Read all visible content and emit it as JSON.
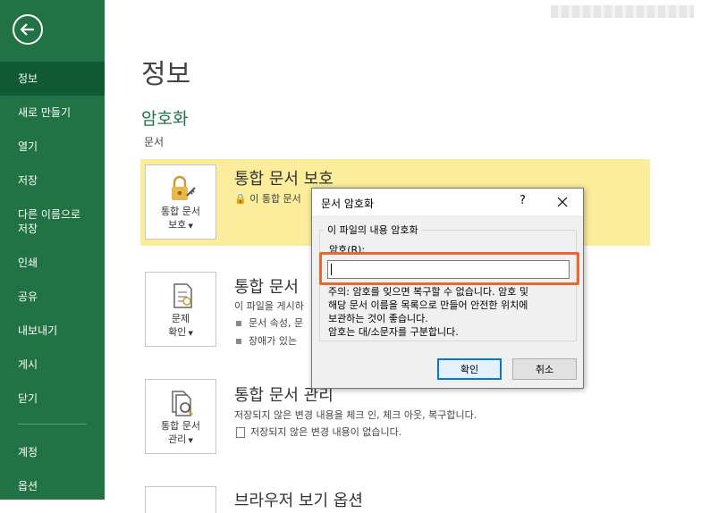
{
  "sidebar": {
    "items": [
      {
        "label": "정보"
      },
      {
        "label": "새로 만들기"
      },
      {
        "label": "열기"
      },
      {
        "label": "저장"
      },
      {
        "label": "다른 이름으로\n저장"
      },
      {
        "label": "인쇄"
      },
      {
        "label": "공유"
      },
      {
        "label": "내보내기"
      },
      {
        "label": "게시"
      },
      {
        "label": "닫기"
      },
      {
        "label": "계정"
      },
      {
        "label": "옵션"
      }
    ]
  },
  "page": {
    "title": "정보",
    "section_title": "암호화",
    "section_sub": "문서"
  },
  "cards": {
    "protect": {
      "tile_label_1": "통합 문서",
      "tile_label_2": "보호",
      "title": "통합 문서 보호",
      "text": "이 통합 문서"
    },
    "inspect": {
      "tile_label_1": "문제",
      "tile_label_2": "확인",
      "title": "통합 문서",
      "text": "이 파일을 게시하",
      "bullet_1": "문서 속성, 문",
      "bullet_2": "장애가 있는"
    },
    "manage": {
      "tile_label_1": "통합 문서",
      "tile_label_2": "관리",
      "title": "통합 문서 관리",
      "text": "저장되지 않은 변경 내용을 체크 인, 체크 아웃, 복구합니다.",
      "sub_text": "저장되지 않은 변경 내용이 없습니다."
    },
    "browser": {
      "title": "브라우저 보기 옵션"
    }
  },
  "dialog": {
    "title": "문서 암호화",
    "help": "?",
    "group_label": "이 파일의 내용 암호화",
    "password_label": "암호(R):",
    "password_value": "",
    "note_lines": [
      "주의: 암호를 잊으면 복구할 수 없습니다. 암호 및",
      "해당 문서 이름을 목록으로 만들어 안전한 위치에",
      "보관하는 것이 좋습니다.",
      "암호는 대/소문자를 구분합니다."
    ],
    "ok_label": "확인",
    "cancel_label": "취소"
  },
  "colors": {
    "accent": "#217346",
    "highlight": "#fbed9b",
    "focus_frame": "#e8692f"
  }
}
